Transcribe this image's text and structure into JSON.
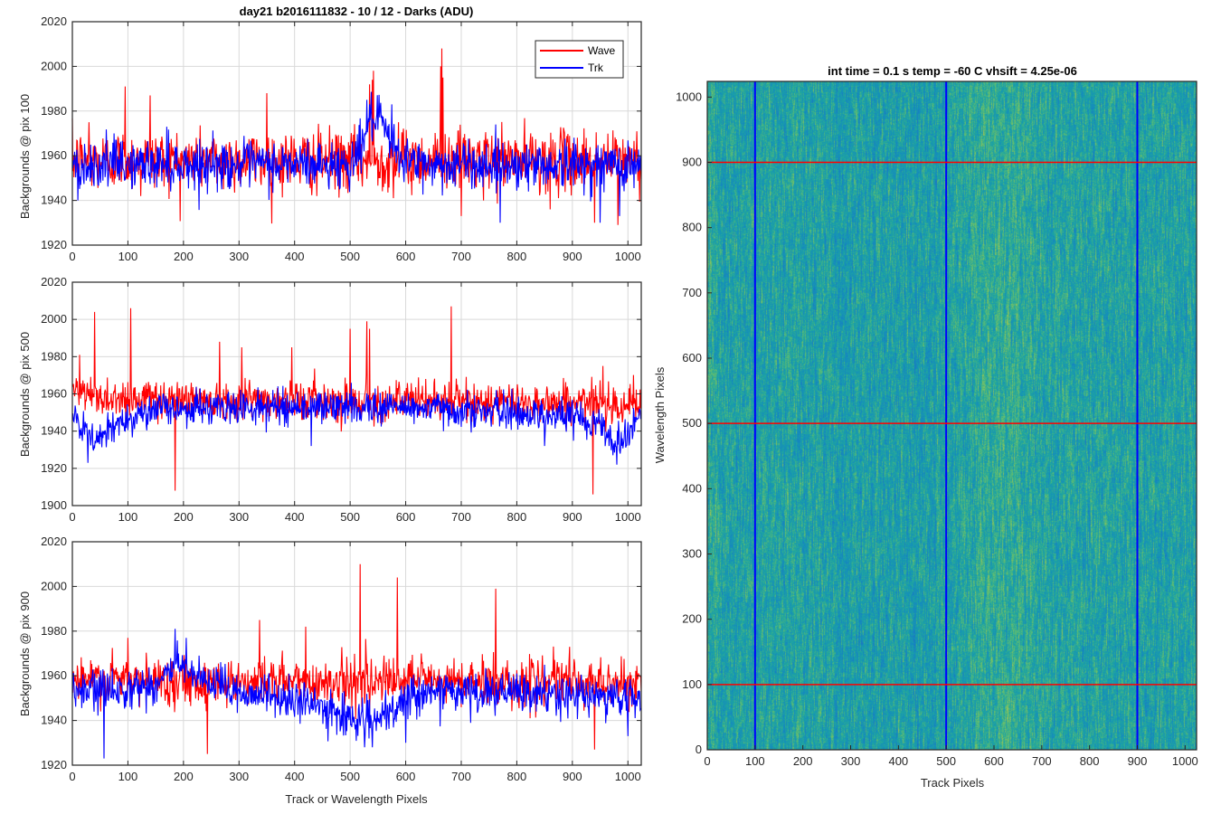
{
  "figure": {
    "main_title": "day21 b2016111832 - 10 / 12 - Darks (ADU)",
    "image_title": "int time = 0.1 s   temp = -60 C   vhsift = 4.25e-06",
    "xlabel_bottom": "Track or Wavelength Pixels",
    "image_xlabel": "Track Pixels",
    "image_ylabel": "Wavelength Pixels",
    "legend": [
      "Wave",
      "Trk"
    ],
    "colors": {
      "wave": "#ff0000",
      "trk": "#0000ff",
      "grid": "#d9d9d9",
      "axis": "#262626"
    }
  },
  "chart_data": [
    {
      "type": "line",
      "title": "day21 b2016111832 - 10 / 12 - Darks (ADU)",
      "ylabel": "Backgrounds @ pix 100",
      "xlabel": "",
      "xlim": [
        0,
        1024
      ],
      "ylim": [
        1920,
        2020
      ],
      "xticks": [
        0,
        100,
        200,
        300,
        400,
        500,
        600,
        700,
        800,
        900,
        1000
      ],
      "yticks": [
        1920,
        1940,
        1960,
        1980,
        2000,
        2020
      ],
      "grid": true,
      "legend_position": "top-right",
      "series": [
        {
          "name": "Wave",
          "color": "#ff0000",
          "baseline": 1958,
          "noise": 9,
          "anchors": [
            [
              0,
              1958
            ],
            [
              1024,
              1958
            ]
          ],
          "spikes": [
            [
              30,
              1975
            ],
            [
              95,
              1991
            ],
            [
              123,
              1942
            ],
            [
              140,
              1987
            ],
            [
              272,
              1945
            ],
            [
              350,
              1988
            ],
            [
              440,
              1942
            ],
            [
              535,
              1992
            ],
            [
              540,
              1994
            ],
            [
              542,
              1998
            ],
            [
              587,
              1975
            ],
            [
              663,
              2000
            ],
            [
              665,
              2008
            ],
            [
              667,
              1995
            ],
            [
              700,
              1933
            ],
            [
              740,
              1940
            ],
            [
              860,
              1936
            ],
            [
              940,
              1930
            ],
            [
              982,
              1929
            ]
          ]
        },
        {
          "name": "Trk",
          "color": "#0000ff",
          "baseline": 1956,
          "noise": 7,
          "anchors": [
            [
              0,
              1956
            ],
            [
              500,
              1956
            ],
            [
              520,
              1965
            ],
            [
              540,
              1978
            ],
            [
              560,
              1972
            ],
            [
              580,
              1962
            ],
            [
              620,
              1956
            ],
            [
              1024,
              1956
            ]
          ],
          "spikes": [
            [
              10,
              1940
            ],
            [
              75,
              1970
            ],
            [
              170,
              1973
            ],
            [
              530,
              1985
            ],
            [
              535,
              1983
            ],
            [
              575,
              1983
            ],
            [
              770,
              1930
            ],
            [
              950,
              1930
            ],
            [
              985,
              1933
            ]
          ]
        }
      ]
    },
    {
      "type": "line",
      "ylabel": "Backgrounds @ pix 500",
      "xlabel": "",
      "xlim": [
        0,
        1024
      ],
      "ylim": [
        1900,
        2020
      ],
      "xticks": [
        0,
        100,
        200,
        300,
        400,
        500,
        600,
        700,
        800,
        900,
        1000
      ],
      "yticks": [
        1900,
        1920,
        1940,
        1960,
        1980,
        2000,
        2020
      ],
      "grid": true,
      "series": [
        {
          "name": "Wave",
          "color": "#ff0000",
          "baseline": 1958,
          "noise": 7,
          "anchors": [
            [
              0,
              1962
            ],
            [
              40,
              1958
            ],
            [
              1024,
              1955
            ]
          ],
          "spikes": [
            [
              13,
              1981
            ],
            [
              40,
              2004
            ],
            [
              105,
              2006
            ],
            [
              185,
              1908
            ],
            [
              265,
              1988
            ],
            [
              305,
              1985
            ],
            [
              395,
              1985
            ],
            [
              500,
              1995
            ],
            [
              530,
              1999
            ],
            [
              535,
              1995
            ],
            [
              682,
              2007
            ],
            [
              937,
              1906
            ],
            [
              955,
              1975
            ]
          ]
        },
        {
          "name": "Trk",
          "color": "#0000ff",
          "baseline": 1952,
          "noise": 6,
          "anchors": [
            [
              0,
              1948
            ],
            [
              20,
              1940
            ],
            [
              40,
              1935
            ],
            [
              60,
              1938
            ],
            [
              100,
              1948
            ],
            [
              160,
              1952
            ],
            [
              400,
              1953
            ],
            [
              600,
              1953
            ],
            [
              900,
              1948
            ],
            [
              950,
              1945
            ],
            [
              975,
              1932
            ],
            [
              1000,
              1940
            ],
            [
              1024,
              1950
            ]
          ],
          "spikes": [
            [
              28,
              1923
            ],
            [
              980,
              1922
            ],
            [
              850,
              1932
            ],
            [
              430,
              1932
            ]
          ]
        }
      ]
    },
    {
      "type": "line",
      "ylabel": "Backgrounds @ pix 900",
      "xlabel": "Track or Wavelength Pixels",
      "xlim": [
        0,
        1024
      ],
      "ylim": [
        1920,
        2020
      ],
      "xticks": [
        0,
        100,
        200,
        300,
        400,
        500,
        600,
        700,
        800,
        900,
        1000
      ],
      "yticks": [
        1920,
        1940,
        1960,
        1980,
        2000,
        2020
      ],
      "grid": true,
      "series": [
        {
          "name": "Wave",
          "color": "#ff0000",
          "baseline": 1958,
          "noise": 7,
          "anchors": [
            [
              0,
              1958
            ],
            [
              1024,
              1957
            ]
          ],
          "spikes": [
            [
              100,
              1977
            ],
            [
              243,
              1925
            ],
            [
              337,
              1985
            ],
            [
              420,
              1982
            ],
            [
              518,
              2010
            ],
            [
              585,
              2004
            ],
            [
              762,
              1999
            ],
            [
              628,
              1970
            ],
            [
              895,
              1973
            ],
            [
              940,
              1927
            ]
          ]
        },
        {
          "name": "Trk",
          "color": "#0000ff",
          "baseline": 1952,
          "noise": 6,
          "anchors": [
            [
              0,
              1952
            ],
            [
              150,
              1956
            ],
            [
              190,
              1966
            ],
            [
              220,
              1958
            ],
            [
              300,
              1953
            ],
            [
              380,
              1950
            ],
            [
              430,
              1947
            ],
            [
              520,
              1940
            ],
            [
              560,
              1940
            ],
            [
              620,
              1953
            ],
            [
              800,
              1952
            ],
            [
              1024,
              1950
            ]
          ],
          "spikes": [
            [
              57,
              1923
            ],
            [
              185,
              1981
            ],
            [
              205,
              1977
            ],
            [
              540,
              1928
            ],
            [
              600,
              1930
            ],
            [
              1000,
              1933
            ]
          ]
        }
      ]
    },
    {
      "type": "heatmap",
      "title": "int time = 0.1 s   temp = -60 C   vhsift = 4.25e-06",
      "xlabel": "Track Pixels",
      "ylabel": "Wavelength Pixels",
      "xlim": [
        0,
        1024
      ],
      "ylim": [
        0,
        1024
      ],
      "xticks": [
        0,
        100,
        200,
        300,
        400,
        500,
        600,
        700,
        800,
        900,
        1000
      ],
      "yticks": [
        0,
        100,
        200,
        300,
        400,
        500,
        600,
        700,
        800,
        900,
        1000
      ],
      "colormap": "parula",
      "vertical_markers": [
        100,
        500,
        900
      ],
      "vertical_marker_color": "#0000ff",
      "horizontal_markers": [
        100,
        500,
        900
      ],
      "horizontal_marker_color": "#ff0000",
      "bright_band_x": [
        520,
        720
      ],
      "dim_band_x": [
        240,
        480
      ]
    }
  ]
}
